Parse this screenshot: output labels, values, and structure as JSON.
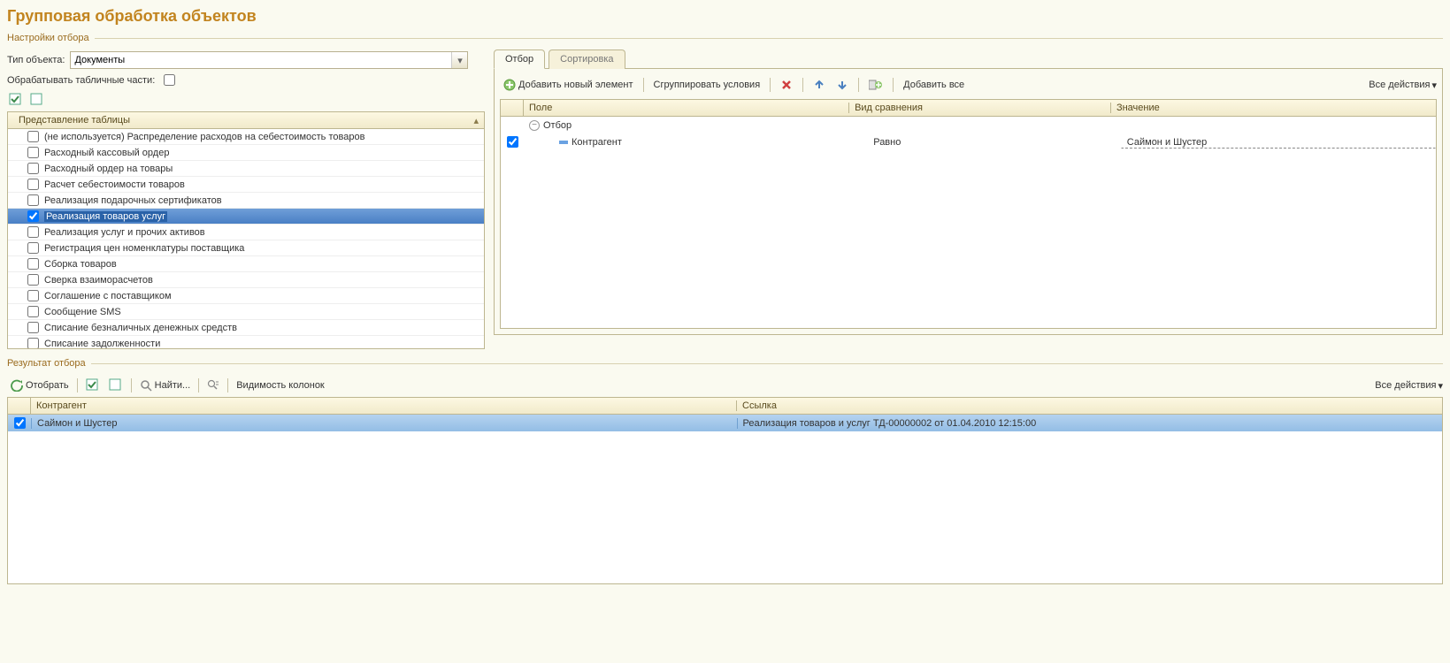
{
  "title": "Групповая обработка объектов",
  "section_settings": "Настройки отбора",
  "section_result": "Результат отбора",
  "type_label": "Тип объекта:",
  "type_value": "Документы",
  "process_tab_parts_label": "Обрабатывать табличные части:",
  "table_view_header": "Представление таблицы",
  "tree_items": [
    {
      "label": "(не используется) Распределение расходов на себестоимость товаров",
      "checked": false
    },
    {
      "label": "Расходный кассовый ордер",
      "checked": false
    },
    {
      "label": "Расходный ордер на товары",
      "checked": false
    },
    {
      "label": "Расчет себестоимости товаров",
      "checked": false
    },
    {
      "label": "Реализация подарочных сертификатов",
      "checked": false
    },
    {
      "label": "Реализация товаров услуг",
      "checked": true,
      "selected": true
    },
    {
      "label": "Реализация услуг и прочих активов",
      "checked": false
    },
    {
      "label": "Регистрация цен номенклатуры поставщика",
      "checked": false
    },
    {
      "label": "Сборка товаров",
      "checked": false
    },
    {
      "label": "Сверка взаиморасчетов",
      "checked": false
    },
    {
      "label": "Соглашение с поставщиком",
      "checked": false
    },
    {
      "label": "Сообщение SMS",
      "checked": false
    },
    {
      "label": "Списание безналичных денежных средств",
      "checked": false
    },
    {
      "label": "Списание задолженности",
      "checked": false
    }
  ],
  "tabs": {
    "filter": "Отбор",
    "sort": "Сортировка"
  },
  "filter_toolbar": {
    "add": "Добавить новый элемент",
    "group": "Сгруппировать условия",
    "add_all": "Добавить все",
    "all_actions": "Все действия"
  },
  "filter_headers": {
    "field": "Поле",
    "comparison": "Вид сравнения",
    "value": "Значение"
  },
  "filter_rows": {
    "root": "Отбор",
    "item1": {
      "field": "Контрагент",
      "comp": "Равно",
      "value": "Саймон и Шустер"
    }
  },
  "result_toolbar": {
    "select": "Отобрать",
    "find": "Найти...",
    "visibility": "Видимость колонок",
    "all_actions": "Все действия"
  },
  "result_headers": {
    "contractor": "Контрагент",
    "link": "Ссылка"
  },
  "result_rows": [
    {
      "checked": true,
      "contractor": "Саймон и Шустер",
      "link": "Реализация товаров и услуг ТД-00000002 от 01.04.2010 12:15:00"
    }
  ]
}
